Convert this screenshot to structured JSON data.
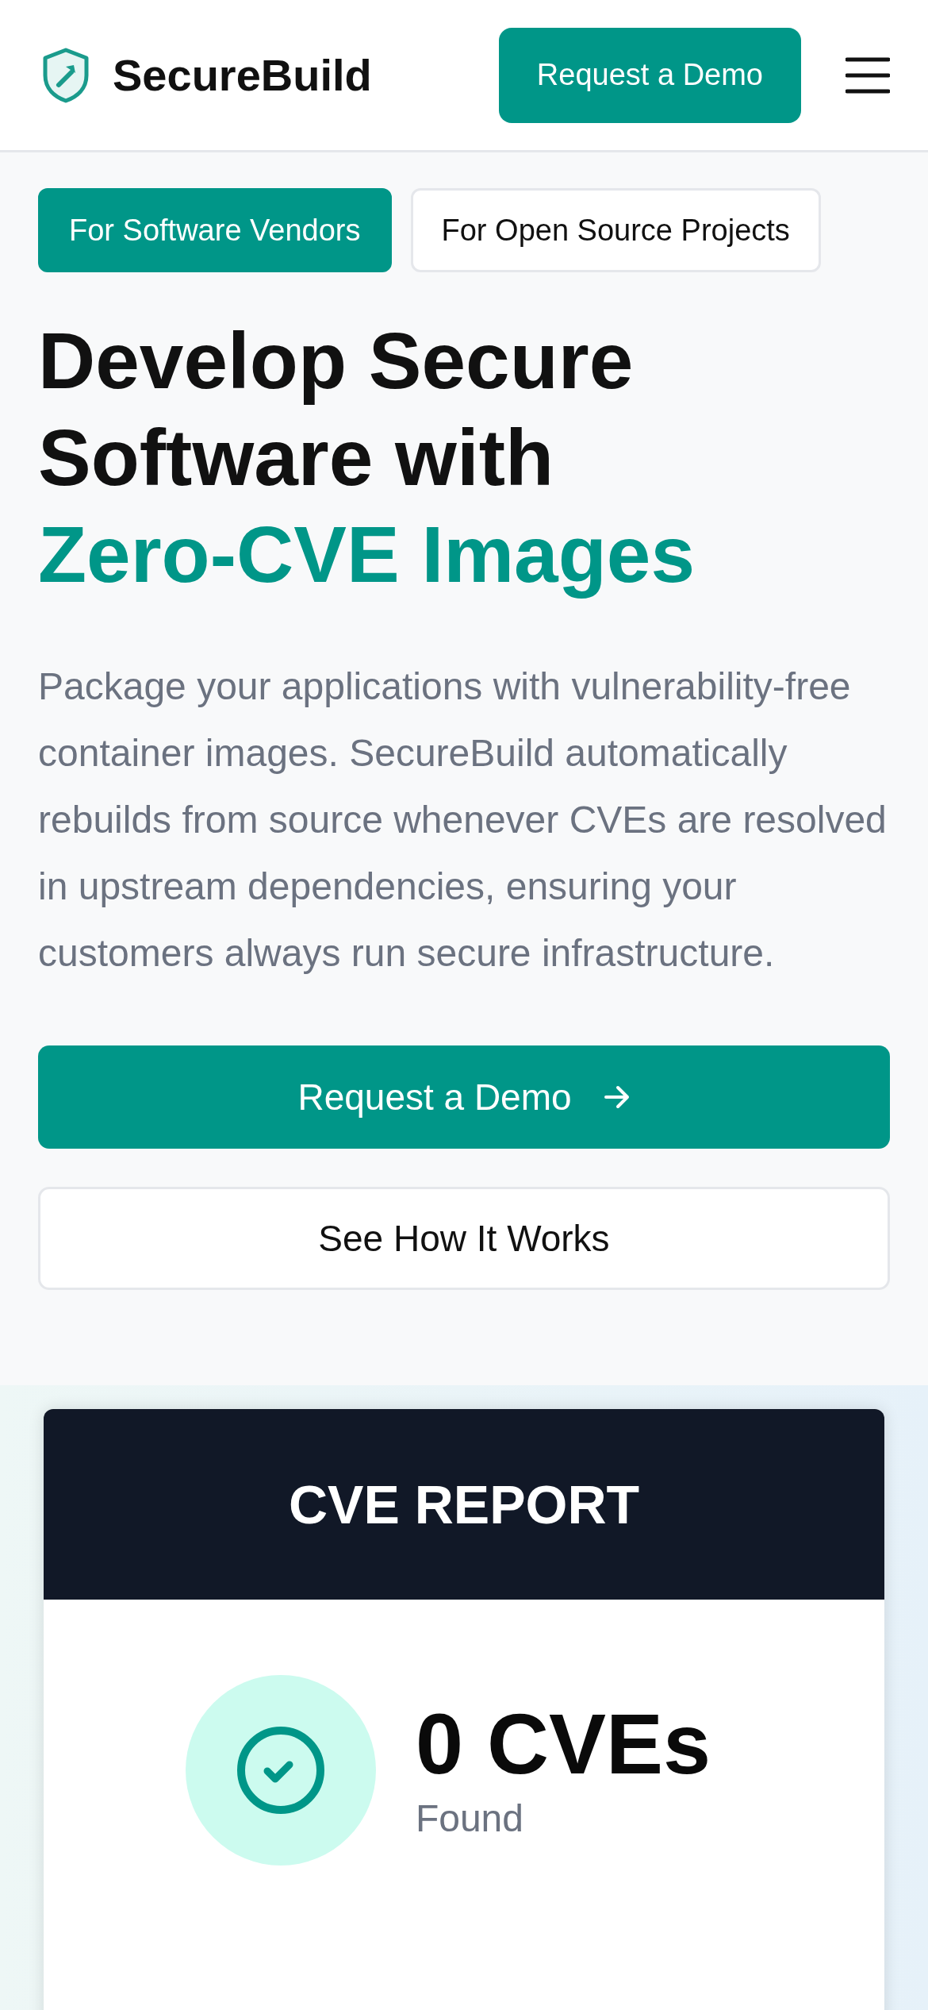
{
  "header": {
    "brand": "SecureBuild",
    "cta": "Request a Demo"
  },
  "audience_tabs": [
    {
      "label": "For Software Vendors",
      "selected": true
    },
    {
      "label": "For Open Source Projects",
      "selected": false
    }
  ],
  "hero": {
    "headline": "Develop Secure Software with",
    "highlight": "Zero-CVE Images",
    "description": "Package your applications with vulnerability-free container images. SecureBuild automatically rebuilds from source whenever CVEs are resolved in upstream dependencies, ensuring your customers always run secure infrastructure.",
    "primary_button": "Request a Demo",
    "secondary_button": "See How It Works"
  },
  "report_card": {
    "title": "CVE REPORT",
    "count": "0 CVEs",
    "caption": "Found"
  }
}
